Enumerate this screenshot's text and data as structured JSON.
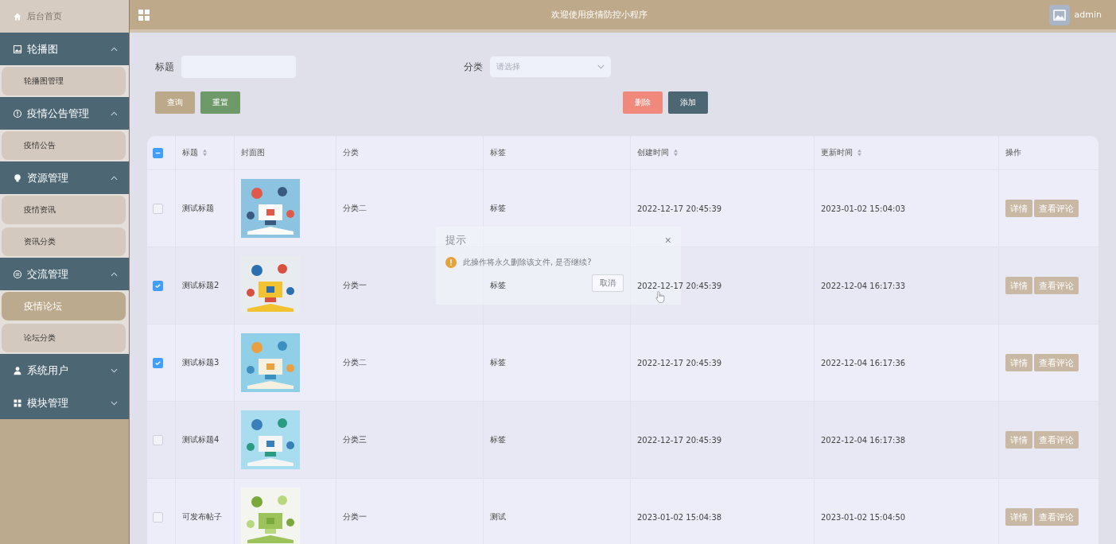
{
  "sidebar": {
    "home": "后台首页",
    "groups": [
      {
        "label": "轮播图",
        "expanded": true,
        "items": [
          {
            "label": "轮播图管理",
            "selected": false
          }
        ]
      },
      {
        "label": "疫情公告管理",
        "expanded": true,
        "items": [
          {
            "label": "疫情公告",
            "selected": false
          }
        ]
      },
      {
        "label": "资源管理",
        "expanded": true,
        "items": [
          {
            "label": "疫情资讯",
            "selected": false
          },
          {
            "label": "资讯分类",
            "selected": false
          }
        ]
      },
      {
        "label": "交流管理",
        "expanded": true,
        "items": [
          {
            "label": "疫情论坛",
            "selected": true
          },
          {
            "label": "论坛分类",
            "selected": false
          }
        ]
      },
      {
        "label": "系统用户",
        "expanded": false
      },
      {
        "label": "模块管理",
        "expanded": false
      }
    ]
  },
  "header": {
    "title": "欢迎使用疫情防控小程序",
    "user": "admin"
  },
  "filters": {
    "title_label": "标题",
    "category_label": "分类",
    "category_placeholder": "请选择"
  },
  "buttons": {
    "search": "查询",
    "reset": "重置",
    "delete": "删除",
    "add": "添加"
  },
  "table": {
    "indeterminate": true,
    "columns": [
      {
        "label": "标题",
        "sortable": true
      },
      {
        "label": "封面图",
        "sortable": false
      },
      {
        "label": "分类",
        "sortable": false
      },
      {
        "label": "标签",
        "sortable": false
      },
      {
        "label": "创建时间",
        "sortable": true
      },
      {
        "label": "更新时间",
        "sortable": true
      },
      {
        "label": "操作",
        "sortable": false
      }
    ],
    "rows": [
      {
        "checked": false,
        "title": "测试标题",
        "category": "分类二",
        "tag": "标签",
        "created": "2022-12-17 20:45:39",
        "updated": "2023-01-02 15:04:03",
        "actions": [
          "详情",
          "查看评论"
        ]
      },
      {
        "checked": true,
        "title": "测试标题2",
        "category": "分类一",
        "tag": "标签",
        "created": "2022-12-17 20:45:39",
        "updated": "2022-12-04 16:17:33",
        "actions": [
          "详情",
          "查看评论"
        ]
      },
      {
        "checked": true,
        "title": "测试标题3",
        "category": "分类二",
        "tag": "标签",
        "created": "2022-12-17 20:45:39",
        "updated": "2022-12-04 16:17:36",
        "actions": [
          "详情",
          "查看评论"
        ]
      },
      {
        "checked": false,
        "title": "测试标题4",
        "category": "分类三",
        "tag": "标签",
        "created": "2022-12-17 20:45:39",
        "updated": "2022-12-04 16:17:38",
        "actions": [
          "详情",
          "查看评论"
        ]
      },
      {
        "checked": false,
        "title": "可发布帖子",
        "category": "分类一",
        "tag": "测试",
        "created": "2023-01-02 15:04:38",
        "updated": "2023-01-02 15:04:50",
        "actions": [
          "详情",
          "查看评论"
        ]
      }
    ]
  },
  "dialog": {
    "title": "提示",
    "close": "×",
    "message": "此操作将永久删除该文件, 是否继续?",
    "cancel": "取消"
  }
}
